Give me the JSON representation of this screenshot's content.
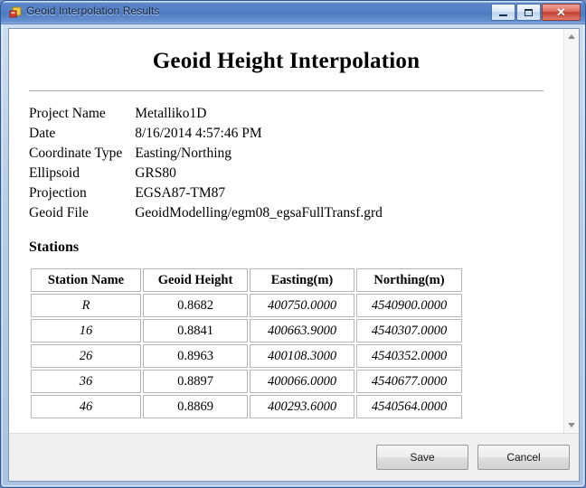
{
  "window": {
    "title": "Geoid Interpolation Results",
    "icon": "app-form-icon",
    "controls": {
      "minimize": "minimize-icon",
      "maximize": "maximize-icon",
      "close": "✕"
    },
    "chrome_color": "#5480c5",
    "close_color": "#c13f2e"
  },
  "document": {
    "title": "Geoid Height Interpolation",
    "meta": [
      {
        "key": "Project Name",
        "value": "Metalliko1D"
      },
      {
        "key": "Date",
        "value": "8/16/2014 4:57:46 PM"
      },
      {
        "key": "Coordinate Type",
        "value": "Easting/Northing"
      },
      {
        "key": "Ellipsoid",
        "value": "GRS80"
      },
      {
        "key": "Projection",
        "value": "EGSA87-TM87"
      },
      {
        "key": "Geoid File",
        "value": "GeoidModelling/egm08_egsaFullTransf.grd"
      }
    ],
    "stations_heading": "Stations",
    "stations_table": {
      "columns": [
        "Station Name",
        "Geoid Height",
        "Easting(m)",
        "Northing(m)"
      ],
      "rows": [
        {
          "name": "R",
          "geoid_height": "0.8682",
          "easting": "400750.0000",
          "northing": "4540900.0000"
        },
        {
          "name": "16",
          "geoid_height": "0.8841",
          "easting": "400663.9000",
          "northing": "4540307.0000"
        },
        {
          "name": "26",
          "geoid_height": "0.8963",
          "easting": "400108.3000",
          "northing": "4540352.0000"
        },
        {
          "name": "36",
          "geoid_height": "0.8897",
          "easting": "400066.0000",
          "northing": "4540677.0000"
        },
        {
          "name": "46",
          "geoid_height": "0.8869",
          "easting": "400293.6000",
          "northing": "4540564.0000"
        }
      ]
    }
  },
  "scrollbar": {
    "up_arrow": "scroll-up-icon",
    "down_arrow": "scroll-down-icon"
  },
  "buttons": {
    "save": "Save",
    "cancel": "Cancel"
  }
}
